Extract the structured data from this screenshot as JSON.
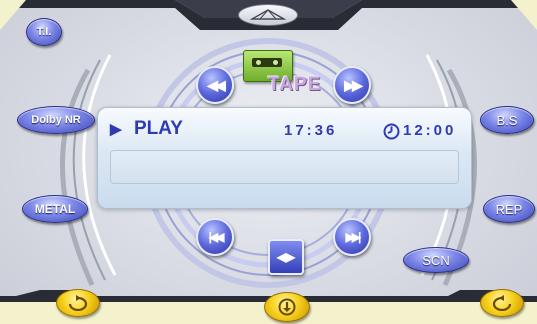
{
  "left_buttons": {
    "ti": "T.I.",
    "dolby_nr": "Dolby NR",
    "metal": "METAL"
  },
  "right_buttons": {
    "bs": "B.S",
    "rep": "REP",
    "scn": "SCN"
  },
  "source": {
    "label": "TAPE",
    "icon": "cassette-tape-icon"
  },
  "transport": {
    "rewind_glyph": "◀◀",
    "fast_forward_glyph": "▶▶",
    "prev_glyph": "|◀◀",
    "next_glyph": "▶▶|",
    "direction_glyph": "◀▶"
  },
  "display": {
    "status_icon": "▶",
    "status": "PLAY",
    "tape_time": "17:36",
    "clock_icon": "clock-icon",
    "clock_time": "12:00"
  },
  "bottom_knobs": {
    "left_icon": "rotate-left-icon",
    "center_icon": "eject-down-icon",
    "right_icon": "rotate-right-icon"
  },
  "colors": {
    "accent_blue": "#3b45b8",
    "display_text": "#2f3bb3",
    "knob_yellow": "#f6d11d",
    "tape_green": "#6fae2c",
    "frame_dark": "#2a2c35",
    "background_cream": "#f4f2cc"
  }
}
